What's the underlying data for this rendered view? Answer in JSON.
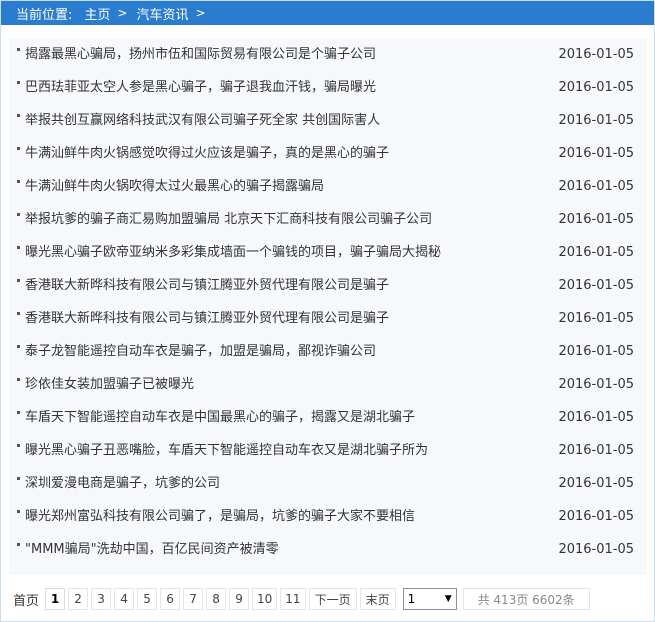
{
  "breadcrumb": {
    "label": "当前位置:",
    "home": "主页",
    "current": "汽车资讯",
    "separator": ">"
  },
  "articles": [
    {
      "title": "揭露最黑心骗局，扬州市伍和国际贸易有限公司是个骗子公司",
      "date": "2016-01-05"
    },
    {
      "title": "巴西珐菲亚太空人参是黑心骗子，骗子退我血汗钱，骗局曝光",
      "date": "2016-01-05"
    },
    {
      "title": "举报共创互赢网络科技武汉有限公司骗子死全家 共创国际害人",
      "date": "2016-01-05"
    },
    {
      "title": "牛满汕鲜牛肉火锅感觉吹得过火应该是骗子，真的是黑心的骗子",
      "date": "2016-01-05"
    },
    {
      "title": "牛满汕鲜牛肉火锅吹得太过火最黑心的骗子揭露骗局",
      "date": "2016-01-05"
    },
    {
      "title": "举报坑爹的骗子商汇易购加盟骗局 北京天下汇商科技有限公司骗子公司",
      "date": "2016-01-05"
    },
    {
      "title": "曝光黑心骗子欧帝亚纳米多彩集成墙面一个骗钱的项目，骗子骗局大揭秘",
      "date": "2016-01-05"
    },
    {
      "title": "香港联大新晔科技有限公司与镇江腾亚外贸代理有限公司是骗子",
      "date": "2016-01-05"
    },
    {
      "title": "香港联大新晔科技有限公司与镇江腾亚外贸代理有限公司是骗子",
      "date": "2016-01-05"
    },
    {
      "title": "泰子龙智能遥控自动车衣是骗子，加盟是骗局，鄙视诈骗公司",
      "date": "2016-01-05"
    },
    {
      "title": "珍依佳女装加盟骗子已被曝光",
      "date": "2016-01-05"
    },
    {
      "title": "车盾天下智能遥控自动车衣是中国最黑心的骗子，揭露又是湖北骗子",
      "date": "2016-01-05"
    },
    {
      "title": "曝光黑心骗子丑恶嘴脸，车盾天下智能遥控自动车衣又是湖北骗子所为",
      "date": "2016-01-05"
    },
    {
      "title": "深圳爱漫电商是骗子，坑爹的公司",
      "date": "2016-01-05"
    },
    {
      "title": "曝光郑州富弘科技有限公司骗了，是骗局，坑爹的骗子大家不要相信",
      "date": "2016-01-05"
    },
    {
      "title": "\"MMM骗局\"洗劫中国，百亿民间资产被清零",
      "date": "2016-01-05"
    }
  ],
  "pagination": {
    "first": "首页",
    "pages": [
      "1",
      "2",
      "3",
      "4",
      "5",
      "6",
      "7",
      "8",
      "9",
      "10",
      "11"
    ],
    "current": "1",
    "next": "下一页",
    "last": "末页",
    "select_value": "1",
    "total": "共 413页 6602条"
  }
}
